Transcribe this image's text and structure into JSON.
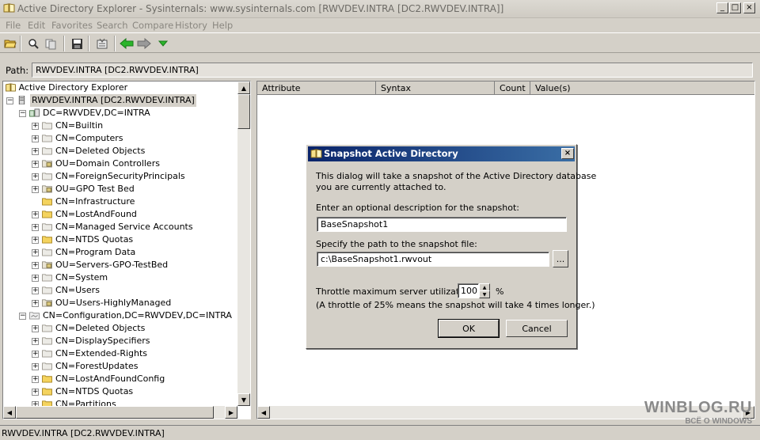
{
  "window": {
    "title": "Active Directory Explorer - Sysinternals: www.sysinternals.com [RWVDEV.INTRA [DC2.RWVDEV.INTRA]]"
  },
  "menu": [
    "File",
    "Edit",
    "Favorites",
    "Search",
    "Compare",
    "History",
    "Help"
  ],
  "toolbar": {
    "buttons": [
      "open-icon",
      "connect-icon",
      "disconnect-icon",
      "save-icon",
      "properties-icon",
      "back-arrow-icon",
      "forward-arrow-icon",
      "history-dropdown-icon"
    ]
  },
  "path": {
    "label": "Path:",
    "value": "RWVDEV.INTRA [DC2.RWVDEV.INTRA]"
  },
  "tree": {
    "root": "Active Directory Explorer",
    "server": "RWVDEV.INTRA [DC2.RWVDEV.INTRA]",
    "domain": "DC=RWVDEV,DC=INTRA",
    "domain_children": [
      {
        "label": "CN=Builtin",
        "icon": "container",
        "exp": true
      },
      {
        "label": "CN=Computers",
        "icon": "container",
        "exp": true
      },
      {
        "label": "CN=Deleted Objects",
        "icon": "container",
        "exp": true
      },
      {
        "label": "OU=Domain Controllers",
        "icon": "ou",
        "exp": true
      },
      {
        "label": "CN=ForeignSecurityPrincipals",
        "icon": "container",
        "exp": true
      },
      {
        "label": "OU=GPO Test Bed",
        "icon": "ou",
        "exp": true
      },
      {
        "label": "CN=Infrastructure",
        "icon": "folder",
        "exp": false
      },
      {
        "label": "CN=LostAndFound",
        "icon": "folder",
        "exp": true
      },
      {
        "label": "CN=Managed Service Accounts",
        "icon": "container",
        "exp": true
      },
      {
        "label": "CN=NTDS Quotas",
        "icon": "folder",
        "exp": true
      },
      {
        "label": "CN=Program Data",
        "icon": "container",
        "exp": true
      },
      {
        "label": "OU=Servers-GPO-TestBed",
        "icon": "ou",
        "exp": true
      },
      {
        "label": "CN=System",
        "icon": "container",
        "exp": true
      },
      {
        "label": "CN=Users",
        "icon": "container",
        "exp": true
      },
      {
        "label": "OU=Users-HighlyManaged",
        "icon": "ou",
        "exp": true
      }
    ],
    "config": "CN=Configuration,DC=RWVDEV,DC=INTRA",
    "config_children": [
      {
        "label": "CN=Deleted Objects",
        "icon": "container",
        "exp": true
      },
      {
        "label": "CN=DisplaySpecifiers",
        "icon": "container",
        "exp": true
      },
      {
        "label": "CN=Extended-Rights",
        "icon": "container",
        "exp": true
      },
      {
        "label": "CN=ForestUpdates",
        "icon": "container",
        "exp": true
      },
      {
        "label": "CN=LostAndFoundConfig",
        "icon": "folder",
        "exp": true
      },
      {
        "label": "CN=NTDS Quotas",
        "icon": "folder",
        "exp": true
      },
      {
        "label": "CN=Partitions",
        "icon": "folder",
        "exp": true
      }
    ]
  },
  "list": {
    "columns": [
      "Attribute",
      "Syntax",
      "Count",
      "Value(s)"
    ]
  },
  "status": "RWVDEV.INTRA [DC2.RWVDEV.INTRA]",
  "dialog": {
    "title": "Snapshot Active Directory",
    "intro_line1": "This dialog will take a snapshot of the Active Directory database",
    "intro_line2": "you are currently attached to.",
    "desc_label": "Enter an optional description for the snapshot:",
    "desc_value": "BaseSnapshot1",
    "path_label": "Specify the path to the snapshot file:",
    "path_value": "c:\\BaseSnapshot1.rwvout",
    "browse_label": "...",
    "throttle_label": "Throttle maximum server utilization",
    "throttle_value": "100",
    "throttle_unit": "%",
    "throttle_note": "(A throttle of 25% means the snapshot will take 4 times longer.)",
    "ok_label": "OK",
    "cancel_label": "Cancel"
  },
  "watermark": {
    "line1": "WINBLOG.RU",
    "line2": "ВСЁ О WINDOWS"
  }
}
